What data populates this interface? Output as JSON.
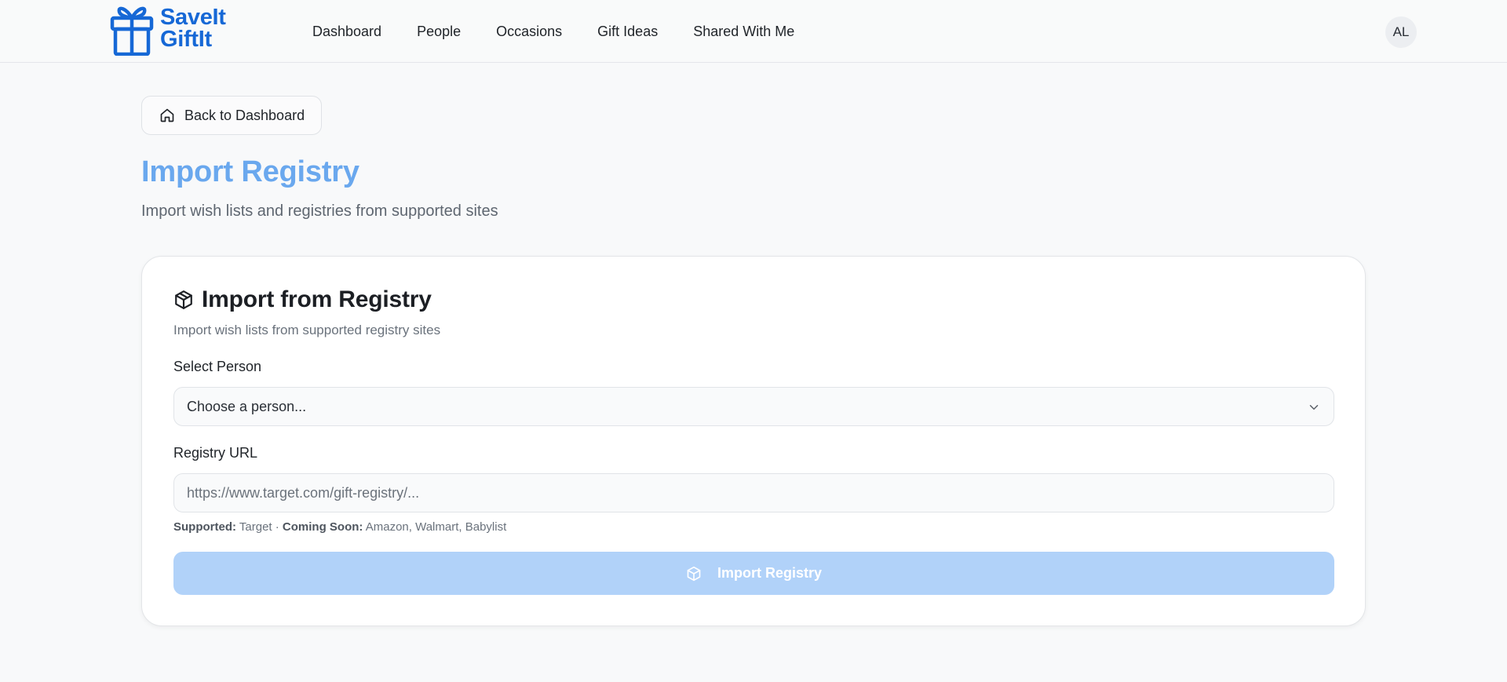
{
  "brand": {
    "line1": "SaveIt",
    "line2": "GiftIt",
    "color": "#1668d6"
  },
  "nav": {
    "items": [
      {
        "label": "Dashboard"
      },
      {
        "label": "People"
      },
      {
        "label": "Occasions"
      },
      {
        "label": "Gift Ideas"
      },
      {
        "label": "Shared With Me"
      }
    ]
  },
  "user": {
    "initials": "AL"
  },
  "back_button": {
    "label": "Back to Dashboard",
    "icon": "home-icon"
  },
  "page": {
    "title": "Import Registry",
    "subtitle": "Import wish lists and registries from supported sites",
    "title_color": "#6aa8ee"
  },
  "card": {
    "title": "Import from Registry",
    "title_icon": "package-icon",
    "subtitle": "Import wish lists from supported registry sites",
    "person": {
      "label": "Select Person",
      "selected": "Choose a person..."
    },
    "url": {
      "label": "Registry URL",
      "placeholder": "https://www.target.com/gift-registry/...",
      "value": ""
    },
    "hint": {
      "supported_label": "Supported:",
      "supported_value": " Target · ",
      "coming_label": "Coming Soon:",
      "coming_value": " Amazon, Walmart, Babylist"
    },
    "submit": {
      "label": "Import Registry",
      "color": "#b1d2f9"
    }
  }
}
